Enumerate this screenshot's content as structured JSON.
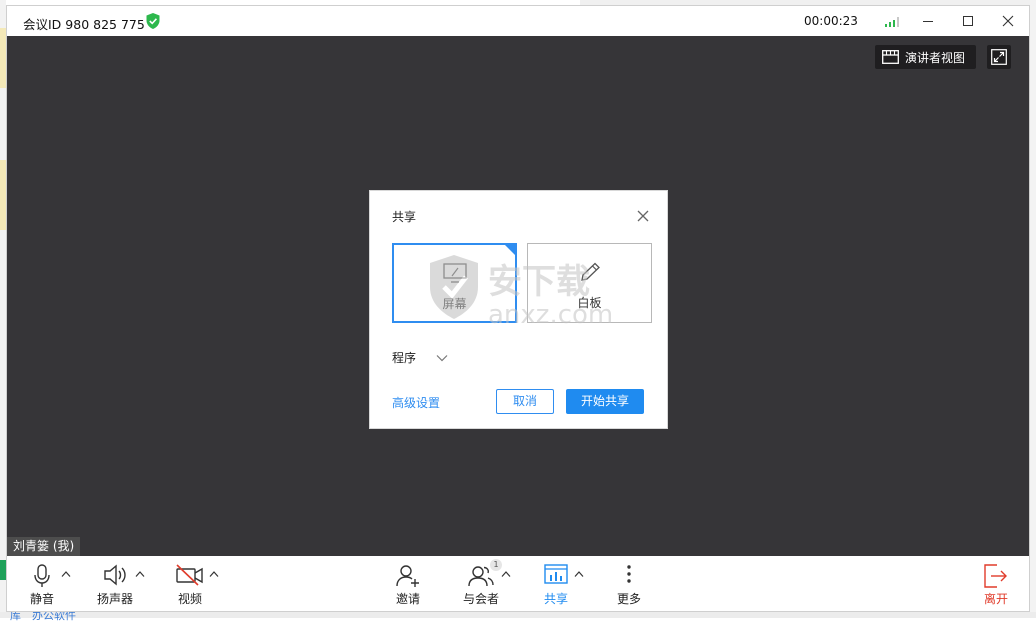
{
  "window": {
    "meeting_id": "会议ID 980 825 775",
    "timer": "00:00:23"
  },
  "stage": {
    "presenter_view_label": "演讲者视图",
    "self_name_tag": "刘青篓 (我)"
  },
  "share_dialog": {
    "title": "共享",
    "options": [
      {
        "label": "屏幕",
        "selected": true
      },
      {
        "label": "白板",
        "selected": false
      }
    ],
    "program_label": "程序",
    "advanced_link": "高级设置",
    "cancel_label": "取消",
    "start_label": "开始共享"
  },
  "toolbar": {
    "mute_label": "静音",
    "speaker_label": "扬声器",
    "video_label": "视频",
    "invite_label": "邀请",
    "participants_label": "与会者",
    "participants_count": "1",
    "share_label": "共享",
    "more_label": "更多",
    "leave_label": "离开"
  },
  "watermark": {
    "text_cn": "安下载",
    "text_en": "anxz.com"
  },
  "background": {
    "bottom_text": "库　办公软件"
  },
  "colors": {
    "accent": "#1f8bf0",
    "stage_bg": "#363538",
    "leave": "#e03b2a",
    "secure_green": "#2db84d"
  }
}
